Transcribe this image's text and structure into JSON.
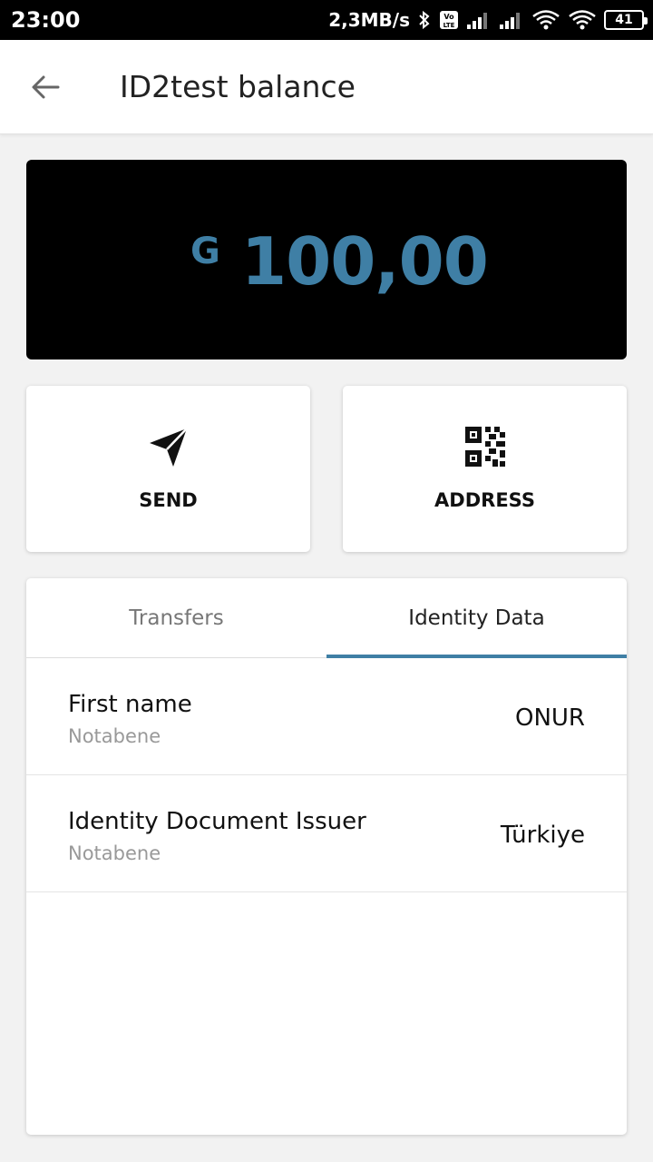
{
  "status_bar": {
    "time": "23:00",
    "net_speed": "2,3MB/s",
    "battery": "41"
  },
  "app_bar": {
    "title": "ID2test balance"
  },
  "balance": {
    "currency_symbol": "G",
    "amount": "100,00",
    "accent_color": "#3f7fa5"
  },
  "actions": {
    "send_label": "SEND",
    "address_label": "ADDRESS"
  },
  "tabs": [
    {
      "label": "Transfers",
      "active": false
    },
    {
      "label": "Identity Data",
      "active": true
    }
  ],
  "identity_rows": [
    {
      "label": "First name",
      "sub": "Notabene",
      "value": "ONUR"
    },
    {
      "label": "Identity Document Issuer",
      "sub": "Notabene",
      "value": "Türkiye"
    }
  ]
}
